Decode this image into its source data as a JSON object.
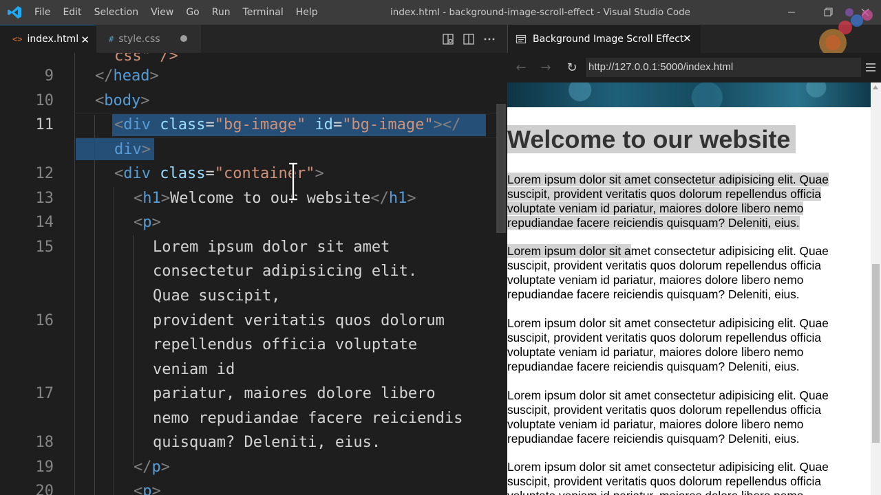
{
  "window": {
    "title": "index.html - background-image-scroll-effect - Visual Studio Code",
    "menu": [
      "File",
      "Edit",
      "Selection",
      "View",
      "Go",
      "Run",
      "Terminal",
      "Help"
    ],
    "controls": {
      "minimize": "minimize-icon",
      "maximize": "restore-icon",
      "close": "close-icon"
    }
  },
  "editor": {
    "tabs": [
      {
        "label": "index.html",
        "icon": "<>",
        "icon_color": "#e37933",
        "active": true,
        "state": "close"
      },
      {
        "label": "style.css",
        "icon": "#",
        "icon_color": "#519aba",
        "active": false,
        "state": "unsaved"
      }
    ],
    "actions": [
      "open-preview-icon",
      "split-editor-icon",
      "more-actions-icon"
    ],
    "active_line": "11",
    "lines": [
      {
        "num": "",
        "text": "css\" />"
      },
      {
        "num": "9",
        "text": "</head>"
      },
      {
        "num": "10",
        "text": "<body>"
      },
      {
        "num": "11",
        "text": "<div class=\"bg-image\" id=\"bg-image\"></"
      },
      {
        "num": "",
        "text": "div>"
      },
      {
        "num": "12",
        "text": "<div class=\"container\">"
      },
      {
        "num": "13",
        "text": "<h1>Welcome to our website</h1>"
      },
      {
        "num": "14",
        "text": "<p>"
      },
      {
        "num": "15",
        "text": "Lorem ipsum dolor sit amet"
      },
      {
        "num": "",
        "text": "consectetur adipisicing elit."
      },
      {
        "num": "",
        "text": "Quae suscipit,"
      },
      {
        "num": "16",
        "text": "provident veritatis quos dolorum"
      },
      {
        "num": "",
        "text": "repellendus officia voluptate"
      },
      {
        "num": "",
        "text": "veniam id"
      },
      {
        "num": "17",
        "text": "pariatur, maiores dolore libero"
      },
      {
        "num": "",
        "text": "nemo repudiandae facere reiciendis"
      },
      {
        "num": "18",
        "text": "quisquam? Deleniti, eius."
      },
      {
        "num": "19",
        "text": "</p>"
      },
      {
        "num": "20",
        "text": "<p>"
      }
    ]
  },
  "preview": {
    "tab_label": "Background Image Scroll Effect",
    "url": "http://127.0.0.1:5000/index.html",
    "heading": "Welcome to our website",
    "paragraph": "Lorem ipsum dolor sit amet consectetur adipisicing elit. Quae suscipit, provident veritatis quos dolorum repellendus officia voluptate veniam id pariatur, maiores dolore libero nemo repudiandae facere reiciendis quisquam? Deleniti, eius.",
    "highlighted_prefix": "Lorem ipsum dolor sit a",
    "paragraph_rest": "met consectetur adipisicing elit. Quae suscipit, provident veritatis quos dolorum repellendus officia voluptate veniam id pariatur, maiores dolore libero nemo repudiandae facere reiciendis quisquam? Deleniti, eius.",
    "scroll_position": 0.45
  },
  "colors": {
    "titlebar": "#3c3c3c",
    "editor_bg": "#1e1e1e",
    "tag": "#569cd6",
    "attribute": "#9cdcfe",
    "string": "#ce9178",
    "selection": "#264f78",
    "preview_highlight": "#d3d3d3"
  }
}
